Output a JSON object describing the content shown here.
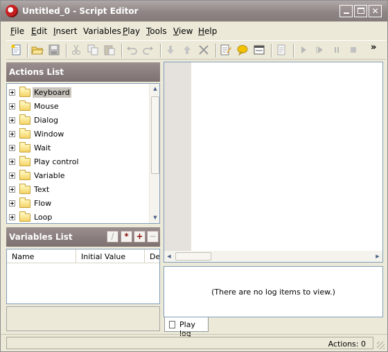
{
  "window": {
    "title": "Untitled_0 - Script Editor"
  },
  "menu": [
    {
      "label": "File",
      "mnemonic": "F",
      "rest": "ile"
    },
    {
      "label": "Edit",
      "mnemonic": "E",
      "rest": "dit"
    },
    {
      "label": "Insert",
      "mnemonic": "I",
      "rest": "nsert"
    },
    {
      "label": "Variables",
      "mnemonic": "",
      "rest": "Variables"
    },
    {
      "label": "Play",
      "mnemonic": "P",
      "rest": "lay"
    },
    {
      "label": "Tools",
      "mnemonic": "T",
      "rest": "ools"
    },
    {
      "label": "View",
      "mnemonic": "V",
      "rest": "iew"
    },
    {
      "label": "Help",
      "mnemonic": "H",
      "rest": "elp"
    }
  ],
  "toolbar": {
    "icons": [
      "new-icon",
      "open-icon",
      "save-icon",
      "cut-icon",
      "copy-icon",
      "paste-icon",
      "undo-icon",
      "redo-icon",
      "move-down-icon",
      "move-up-icon",
      "delete-icon",
      "edit-icon",
      "comment-icon",
      "properties-icon",
      "script-icon",
      "play-icon",
      "play-step-icon",
      "pause-icon",
      "stop-icon"
    ],
    "more": "»"
  },
  "actions_panel": {
    "title": "Actions List",
    "items": [
      {
        "label": "Keyboard",
        "selected": true
      },
      {
        "label": "Mouse",
        "selected": false
      },
      {
        "label": "Dialog",
        "selected": false
      },
      {
        "label": "Window",
        "selected": false
      },
      {
        "label": "Wait",
        "selected": false
      },
      {
        "label": "Play control",
        "selected": false
      },
      {
        "label": "Variable",
        "selected": false
      },
      {
        "label": "Text",
        "selected": false
      },
      {
        "label": "Flow",
        "selected": false
      },
      {
        "label": "Loop",
        "selected": false
      }
    ]
  },
  "variables_panel": {
    "title": "Variables List",
    "tools": [
      "edit-variable-icon",
      "add-variable-icon",
      "plus-icon",
      "minus-icon"
    ],
    "columns": [
      "Name",
      "Initial Value",
      "De"
    ]
  },
  "log": {
    "empty_text": "(There are no log items to view.)",
    "tab_label": "Play log"
  },
  "status": {
    "text": "Actions: 0"
  },
  "colors": {
    "header": "#8a7e7e",
    "selection": "#c8c4bc",
    "accent": "#c82020"
  }
}
